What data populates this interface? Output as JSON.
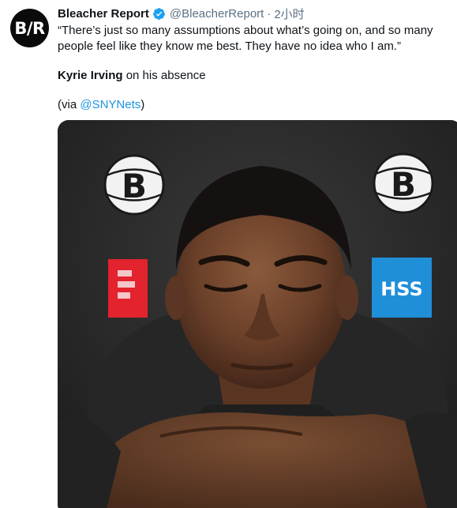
{
  "account": {
    "avatar_text": "B/R",
    "name": "Bleacher Report",
    "handle": "@BleacherReport",
    "separator": "·",
    "time": "2小时"
  },
  "tweet": {
    "quote": "“There’s just so many assumptions about what’s going on, and so many people feel like they know me best. They have no idea who I am.”",
    "speaker_name": "Kyrie Irving",
    "speaker_rest": " on his absence",
    "via_prefix": "(via ",
    "via_link": "@SNYNets",
    "via_suffix": ")"
  },
  "media": {
    "logo_letter": "B",
    "sponsor_text": "HSS",
    "sponsor_color": "#1f8fd8",
    "sponsor_left_color": "#e3232d"
  },
  "colors": {
    "verified": "#1da1f2",
    "link": "#1b95e0",
    "text_primary": "#0f1419",
    "text_secondary": "#5b7083"
  }
}
